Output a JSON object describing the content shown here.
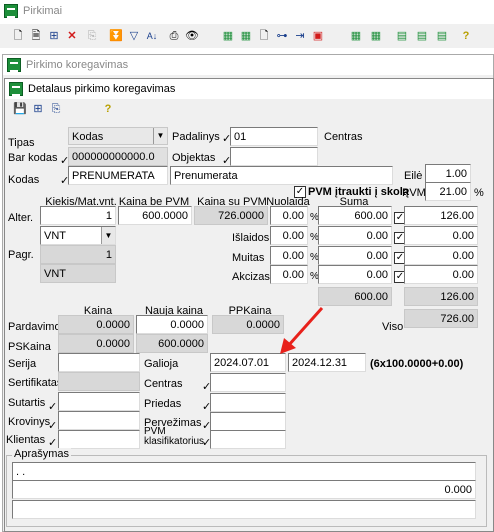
{
  "outer_window": {
    "title": "Pirkimai"
  },
  "outer_toolbar": {
    "icons": [
      "new-doc-icon",
      "doc-icon",
      "tree-icon",
      "delete-icon",
      "copy-icon",
      "filter-stack-icon",
      "filter-icon",
      "sort-az-icon",
      "print-icon",
      "find-icon",
      "calc-red-icon",
      "calc-green-icon",
      "page-icon",
      "tree-icon",
      "export-icon",
      "bag-icon",
      "calc-icon",
      "list-icon",
      "list-down-icon",
      "help-icon"
    ]
  },
  "mid_window": {
    "title": "Pirkimo koregavimas"
  },
  "dialog": {
    "title": "Detalaus pirkimo koregavimas",
    "help_glyph": "?"
  },
  "tipas": {
    "label": "Tipas",
    "value": "Kodas"
  },
  "padalinys": {
    "label": "Padalinys",
    "value": "01",
    "name": "Centras"
  },
  "barkodas": {
    "label": "Bar kodas",
    "value": "000000000000.0"
  },
  "objektas": {
    "label": "Objektas",
    "value": ""
  },
  "kodas": {
    "label": "Kodas",
    "value": "PRENUMERATA",
    "name": "Prenumerata"
  },
  "eile": {
    "label": "Eilė",
    "value": "1.00"
  },
  "pvm_include": {
    "label": "PVM įtraukti į skolą",
    "checked": true
  },
  "pvm": {
    "label": "PVM",
    "value": "21.00",
    "unit": "%"
  },
  "col_headers": {
    "kiekis": "Kiekis/Mat.vnt.",
    "kaina_be": "Kaina be PVM",
    "kaina_su": "Kaina su PVM",
    "nuolaida": "Nuolaida",
    "suma": "Suma"
  },
  "alter": {
    "label": "Alter.",
    "kiekis": "1",
    "kaina_be": "600.0000",
    "kaina_su": "726.0000",
    "nuolaida": "0.00",
    "suma": "600.00",
    "pvm": "126.00"
  },
  "vnt_select": "VNT",
  "islaidos": {
    "label": "Išlaidos",
    "pct": "0.00",
    "suma": "0.00",
    "pvm": "0.00"
  },
  "muitas": {
    "label": "Muitas",
    "pct": "0.00",
    "suma": "0.00",
    "pvm": "0.00"
  },
  "akcizas": {
    "label": "Akcizas",
    "pct": "0.00",
    "suma": "0.00",
    "pvm": "0.00"
  },
  "pagr": {
    "label": "Pagr.",
    "kiekis": "1",
    "unit": "VNT"
  },
  "totals": {
    "suma": "600.00",
    "pvm": "126.00"
  },
  "price_headers": {
    "kaina": "Kaina",
    "nauja": "Nauja kaina",
    "pp": "PPKaina"
  },
  "pardavimo": {
    "label": "Pardavimo",
    "kaina": "0.0000",
    "nauja": "0.0000",
    "pp": "0.0000"
  },
  "pskaina": {
    "label": "PSKaina",
    "kaina": "0.0000",
    "nauja": "600.0000"
  },
  "viso": {
    "label": "Viso",
    "value": "726.00"
  },
  "serija": {
    "label": "Serija",
    "value": ""
  },
  "galioja": {
    "label": "Galioja",
    "from": "2024.07.01",
    "to": "2024.12.31",
    "note": "(6x100.0000+0.00)"
  },
  "sertifikatas": {
    "label": "Sertifikatas"
  },
  "centras": {
    "label": "Centras"
  },
  "sutartis": {
    "label": "Sutartis"
  },
  "priedas": {
    "label": "Priedas"
  },
  "krovinys": {
    "label": "Krovinys"
  },
  "pervezimas": {
    "label": "Pervežimas"
  },
  "klientas": {
    "label": "Klientas"
  },
  "pvm_klas": {
    "label": "PVM klasifikatorius"
  },
  "aprasymas": {
    "label": "Aprašymas",
    "line1": ". .",
    "line2": "",
    "amount": "0.000"
  },
  "arrow_color": "#e8211b"
}
